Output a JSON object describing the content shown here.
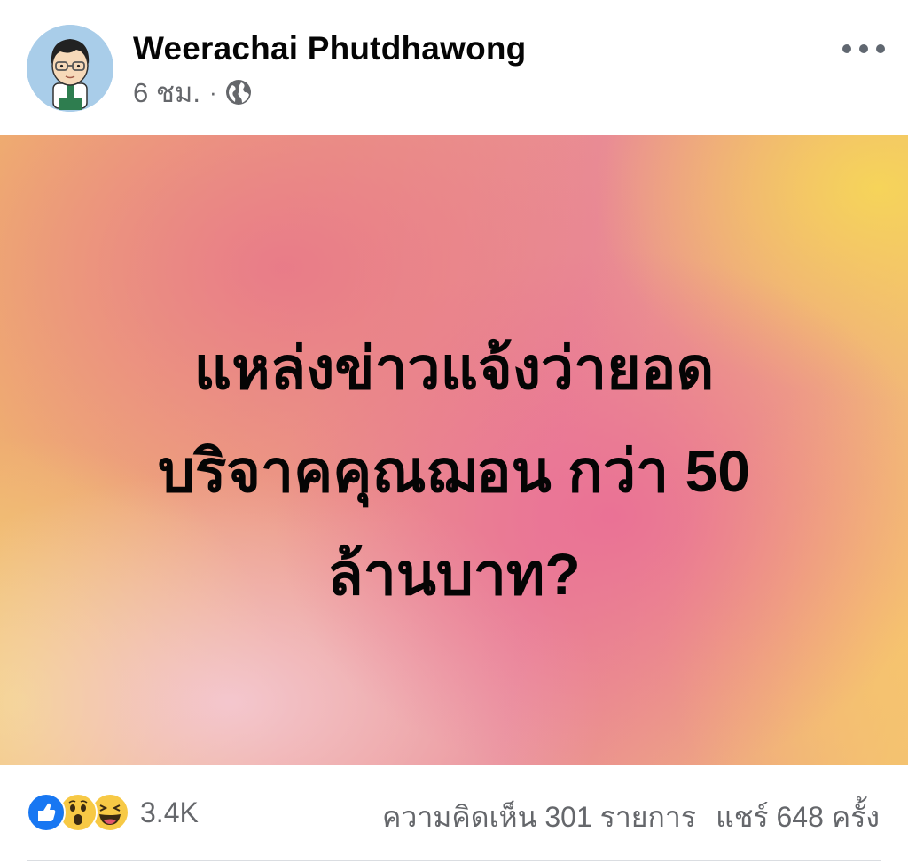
{
  "post": {
    "author": "Weerachai Phutdhawong",
    "time": "6 ชม.",
    "separator": "·",
    "privacy_icon": "globe-icon",
    "more_icon": "more-options-icon",
    "text_lines": [
      "แหล่งข่าวแจ้งว่ายอด",
      "บริจาคคุณฌอน กว่า 50",
      "ล้านบาท?"
    ],
    "background_colors": [
      "#efb06e",
      "#e98b95",
      "#f3c271"
    ]
  },
  "engagement": {
    "reaction_icons": [
      "like-icon",
      "wow-icon",
      "haha-icon"
    ],
    "reaction_count": "3.4K",
    "comments": "ความคิดเห็น 301 รายการ",
    "shares": "แชร์ 648 ครั้ง"
  },
  "colors": {
    "like_blue": "#1877f2",
    "emoji_yellow": "#f7c945",
    "secondary_text": "#65676b"
  }
}
